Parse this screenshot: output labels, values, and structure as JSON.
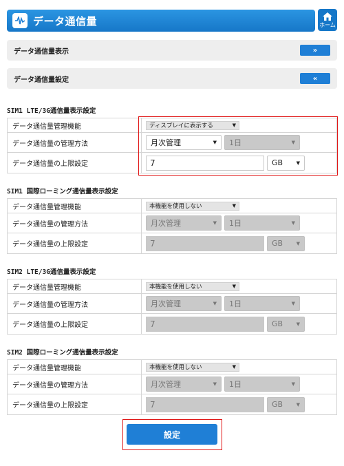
{
  "header": {
    "title": "データ通信量"
  },
  "home": {
    "label": "ホーム"
  },
  "nav": [
    {
      "label": "データ通信量表示",
      "button": "»"
    },
    {
      "label": "データ通信量設定",
      "button": "«"
    }
  ],
  "sections": [
    {
      "title": "SIM1 LTE/3G通信量表示設定",
      "rows": {
        "mgmt_function": {
          "label": "データ通信量管理機能",
          "value": "ディスプレイに表示する"
        },
        "mgmt_method": {
          "label": "データ通信量の管理方法",
          "period": "月次管理",
          "day": "1日"
        },
        "limit": {
          "label": "データ通信量の上限設定",
          "value": "7",
          "unit": "GB"
        }
      }
    },
    {
      "title": "SIM1 国際ローミング通信量表示設定",
      "rows": {
        "mgmt_function": {
          "label": "データ通信量管理機能",
          "value": "本機能を使用しない"
        },
        "mgmt_method": {
          "label": "データ通信量の管理方法",
          "period": "月次管理",
          "day": "1日"
        },
        "limit": {
          "label": "データ通信量の上限設定",
          "value": "7",
          "unit": "GB"
        }
      }
    },
    {
      "title": "SIM2 LTE/3G通信量表示設定",
      "rows": {
        "mgmt_function": {
          "label": "データ通信量管理機能",
          "value": "本機能を使用しない"
        },
        "mgmt_method": {
          "label": "データ通信量の管理方法",
          "period": "月次管理",
          "day": "1日"
        },
        "limit": {
          "label": "データ通信量の上限設定",
          "value": "7",
          "unit": "GB"
        }
      }
    },
    {
      "title": "SIM2 国際ローミング通信量表示設定",
      "rows": {
        "mgmt_function": {
          "label": "データ通信量管理機能",
          "value": "本機能を使用しない"
        },
        "mgmt_method": {
          "label": "データ通信量の管理方法",
          "period": "月次管理",
          "day": "1日"
        },
        "limit": {
          "label": "データ通信量の上限設定",
          "value": "7",
          "unit": "GB"
        }
      }
    }
  ],
  "submit": {
    "label": "設定"
  },
  "colors": {
    "accent": "#1f7fd6",
    "highlight": "#e01515",
    "disabled": "#c9c9c9"
  }
}
